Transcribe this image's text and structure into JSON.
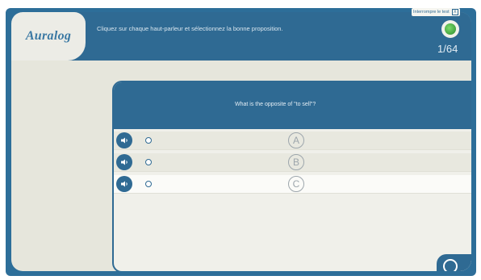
{
  "window": {
    "quit_label": "Interrompre le test",
    "quit_x": "X"
  },
  "header": {
    "logo": "Auralog",
    "instruction": "Cliquez sur chaque haut-parleur et sélectionnez la bonne proposition.",
    "counter": "1/64"
  },
  "question": {
    "text": "What is the opposite of \"to sell\"?",
    "options": [
      {
        "letter": "A"
      },
      {
        "letter": "B"
      },
      {
        "letter": "C"
      }
    ]
  },
  "colors": {
    "primary": "#2f6a93",
    "background": "#e6e6dc",
    "accent": "#3cb043"
  },
  "icons": {
    "speaker": "speaker-icon",
    "next": "next-circle-icon",
    "status": "green-orb-icon"
  }
}
